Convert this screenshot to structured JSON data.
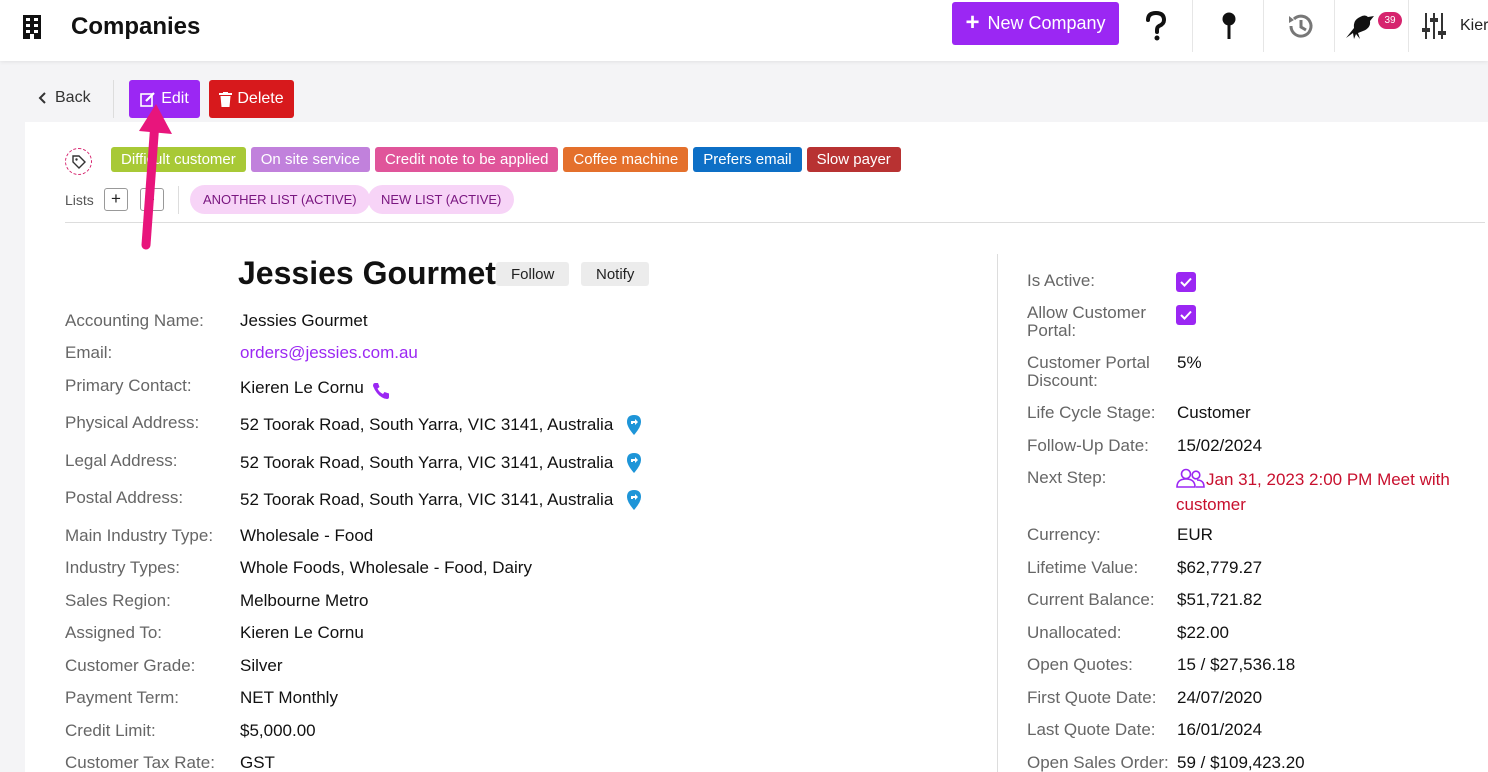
{
  "topbar": {
    "title": "Companies",
    "new_company_label": "New Company",
    "notification_count": "39",
    "user_name": "Kier",
    "icons": [
      "building-icon",
      "help-icon",
      "pin-icon",
      "history-icon",
      "bird-icon",
      "settings-sliders-icon"
    ]
  },
  "actions": {
    "back_label": "Back",
    "edit_label": "Edit",
    "delete_label": "Delete"
  },
  "tags": [
    {
      "label": "Difficult customer",
      "color": "#a8c936"
    },
    {
      "label": "On site service",
      "color": "#c181dc"
    },
    {
      "label": "Credit note to be applied",
      "color": "#e0559a"
    },
    {
      "label": "Coffee machine",
      "color": "#e4702c"
    },
    {
      "label": "Prefers email",
      "color": "#0d6fc6"
    },
    {
      "label": "Slow payer",
      "color": "#b83232"
    }
  ],
  "lists": {
    "label": "Lists",
    "items": [
      "ANOTHER LIST (ACTIVE)",
      "NEW LIST (ACTIVE)"
    ]
  },
  "company": {
    "name": "Jessies Gourmet",
    "follow_label": "Follow",
    "notify_label": "Notify"
  },
  "details": [
    {
      "label": "Accounting Name:",
      "value": "Jessies Gourmet"
    },
    {
      "label": "Email:",
      "value": "orders@jessies.com.au"
    },
    {
      "label": "Primary Contact:",
      "value": "Kieren Le Cornu"
    },
    {
      "label": "Physical Address:",
      "value": "52 Toorak Road, South Yarra, VIC 3141, Australia"
    },
    {
      "label": "Legal Address:",
      "value": "52 Toorak Road, South Yarra, VIC 3141, Australia"
    },
    {
      "label": "Postal Address:",
      "value": "52 Toorak Road, South Yarra, VIC 3141, Australia"
    },
    {
      "label": "Main Industry Type:",
      "value": "Wholesale - Food"
    },
    {
      "label": "Industry Types:",
      "value": "Whole Foods, Wholesale - Food, Dairy"
    },
    {
      "label": "Sales Region:",
      "value": "Melbourne Metro"
    },
    {
      "label": "Assigned To:",
      "value": "Kieren Le Cornu"
    },
    {
      "label": "Customer Grade:",
      "value": "Silver"
    },
    {
      "label": "Payment Term:",
      "value": "NET Monthly"
    },
    {
      "label": "Credit Limit:",
      "value": "$5,000.00"
    },
    {
      "label": "Customer Tax Rate:",
      "value": "GST"
    }
  ],
  "side": {
    "is_active_label": "Is Active:",
    "allow_portal_label": "Allow Customer Portal:",
    "portal_discount_label": "Customer Portal Discount:",
    "portal_discount_value": "5%",
    "lifecycle_label": "Life Cycle Stage:",
    "lifecycle_value": "Customer",
    "followup_label": "Follow-Up Date:",
    "followup_value": "15/02/2024",
    "next_step_label": "Next Step:",
    "next_step_value": "Jan 31, 2023 2:00 PM Meet with customer",
    "currency_label": "Currency:",
    "currency_value": "EUR",
    "lifetime_label": "Lifetime Value:",
    "lifetime_value": "$62,779.27",
    "balance_label": "Current Balance:",
    "balance_value": "$51,721.82",
    "unallocated_label": "Unallocated:",
    "unallocated_value": "$22.00",
    "open_quotes_label": "Open Quotes:",
    "open_quotes_value": "15 / $27,536.18",
    "first_quote_label": "First Quote Date:",
    "first_quote_value": "24/07/2020",
    "last_quote_label": "Last Quote Date:",
    "last_quote_value": "16/01/2024",
    "open_sales_label": "Open Sales Order:",
    "open_sales_value": "59 / $109,423.20"
  },
  "colors": {
    "accent": "#9b27f3",
    "danger": "#d7191c",
    "annotation_arrow": "#e8157c"
  }
}
